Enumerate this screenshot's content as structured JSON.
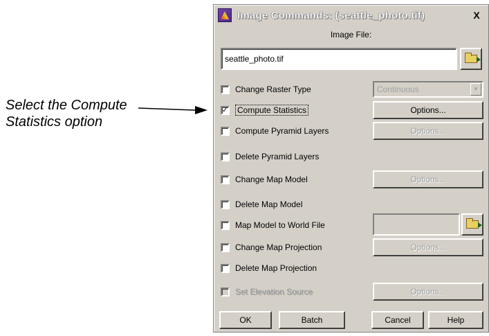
{
  "annotation": {
    "line1": "Select the Compute",
    "line2": "Statistics option"
  },
  "dialog": {
    "title": "Image Commands: (seattle_photo.tif)",
    "close_label": "X",
    "image_file_label": "Image File:",
    "image_file_value": "seattle_photo.tif",
    "raster_type_value": "Continuous",
    "options": [
      {
        "label": "Change Raster Type",
        "checked": false,
        "enabled": true
      },
      {
        "label": "Compute Statistics",
        "checked": true,
        "enabled": true
      },
      {
        "label": "Compute Pyramid Layers",
        "checked": false,
        "enabled": true
      },
      {
        "label": "Delete Pyramid Layers",
        "checked": false,
        "enabled": true
      },
      {
        "label": "Change Map Model",
        "checked": false,
        "enabled": true
      },
      {
        "label": "Delete Map Model",
        "checked": false,
        "enabled": true
      },
      {
        "label": "Map Model to World File",
        "checked": false,
        "enabled": true
      },
      {
        "label": "Change Map Projection",
        "checked": false,
        "enabled": true
      },
      {
        "label": "Delete Map Projection",
        "checked": false,
        "enabled": true
      },
      {
        "label": "Set Elevation Source",
        "checked": false,
        "enabled": false
      }
    ],
    "options_button_label": "Options...",
    "buttons": {
      "ok": "OK",
      "batch": "Batch",
      "cancel": "Cancel",
      "help": "Help"
    }
  }
}
